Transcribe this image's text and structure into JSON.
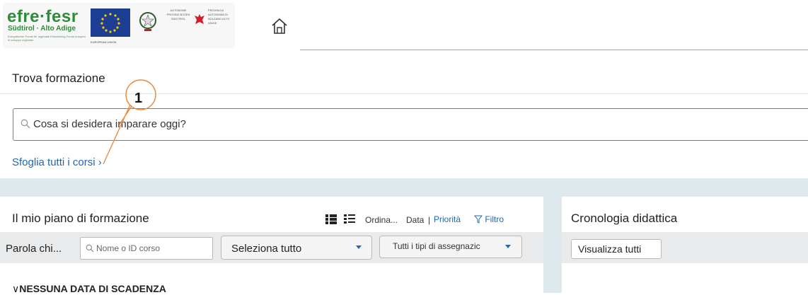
{
  "header": {
    "logo_text": "efre·fesr",
    "logo_subtitle": "Südtirol · Alto Adige",
    "logo_tagline": "Europäischer Fonds für regionale Entwicklung Fondo europeo di sviluppo regionale",
    "eu_caption": "EUROPEAN UNION",
    "autonomy_text": "AUTONOME PROVINZ BOZEN SÜDTIROL",
    "province_text": "PROVINCIA AUTONOMA DI BOLZANO ALTO ADIGE",
    "home_icon": "home-icon"
  },
  "find": {
    "title": "Trova formazione",
    "search_value": "Cosa si desidera imparare oggi?",
    "browse_link": "Sfoglia tutti i corsi",
    "browse_chevron": "›",
    "callout_number": "1"
  },
  "plan": {
    "title": "Il mio piano di formazione",
    "sort_label": "Ordina...",
    "sort_data": "Data",
    "sort_separator": "|",
    "sort_priority": "Priorità",
    "filter_label": "Filtro",
    "keyword_label": "Parola chi...",
    "keyword_placeholder": "Nome o ID corso",
    "select_all": "Seleziona tutto",
    "assignment_types": "Tutti i tipi di assegnazic",
    "group_heading": "NESSUNA DATA DI SCADENZA"
  },
  "history": {
    "title": "Cronologia didattica",
    "view_all": "Visualizza tutti"
  },
  "colors": {
    "accent_blue": "#2266b0",
    "brand_green": "#2e8b3a",
    "band": "#dde9ec"
  }
}
